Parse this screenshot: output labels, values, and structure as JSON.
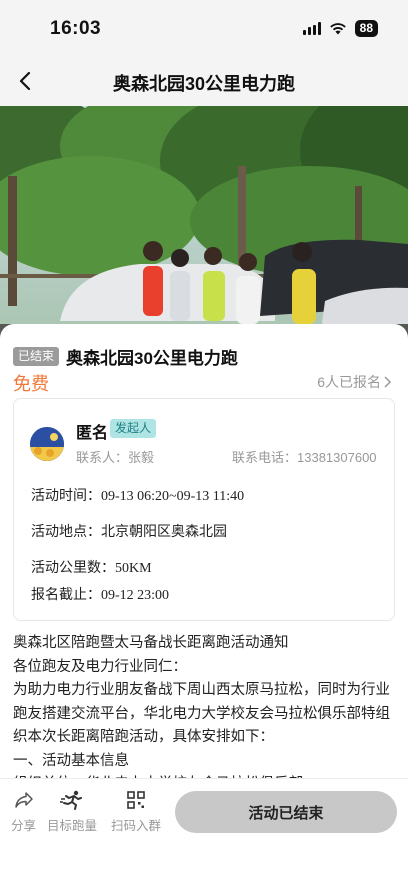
{
  "status_bar": {
    "time": "16:03",
    "battery": "88",
    "icons": [
      "signal-icon",
      "wifi-icon",
      "battery-icon"
    ]
  },
  "nav": {
    "title": "奥森北园30公里电力跑",
    "back_icon": "chevron-left-icon"
  },
  "activity": {
    "status_badge": "已结束",
    "title": "奥森北园30公里电力跑",
    "price": "免费",
    "signup_count": "6人已报名",
    "colors": {
      "price": "#f07a3a",
      "badge_bg": "#9b9b9b",
      "initiator_tag_bg": "#aee4e4",
      "initiator_tag_text": "#1e7f83"
    }
  },
  "organizer": {
    "name": "匿名",
    "tag": "发起人",
    "contact_person": "联系人：张毅",
    "contact_phone": "联系电话：13381307600"
  },
  "details": {
    "time_label": "活动时间：",
    "time_value": "09-13 06:20~09-13 11:40",
    "location_label": "活动地点：",
    "location_value": "北京朝阳区奥森北园",
    "distance_label": "活动公里数：",
    "distance_value": "50KM",
    "deadline_label": "报名截止：",
    "deadline_value": "09-12 23:00"
  },
  "description": [
    "奥森北区陪跑暨太马备战长距离跑活动通知",
    "各位跑友及电力行业同仁：",
    "为助力电力行业朋友备战下周山西太原马拉松，同时为行业跑友搭建交流平台，华北电力大学校友会马拉松俱乐部特组织本次长距离陪跑活动，具体安排如下：",
    "一、活动基本信息",
    "组织单位：华北电力大学校友会马拉松俱乐部"
  ],
  "bottom_bar": {
    "share_label": "分享",
    "target_pace_label": "目标跑量",
    "scan_group_label": "扫码入群",
    "action_button": "活动已结束"
  }
}
